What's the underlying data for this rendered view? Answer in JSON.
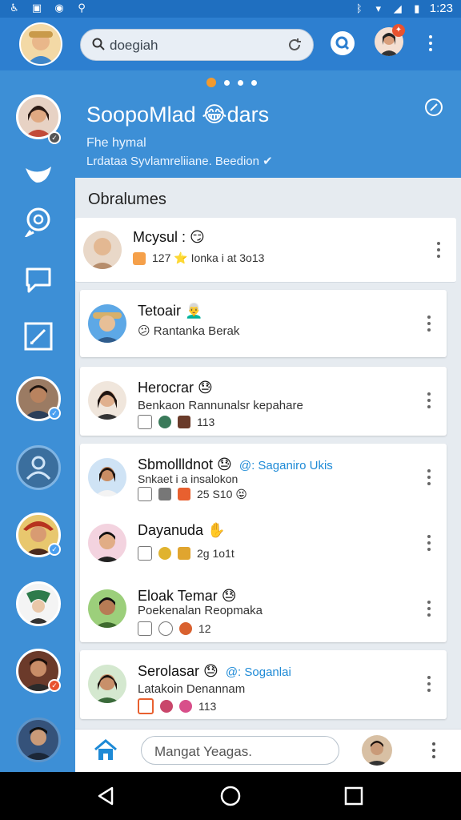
{
  "status_bar": {
    "time": "1:23"
  },
  "search": {
    "query": "doegiah"
  },
  "header": {
    "title": "SoopoMlad 😂dars",
    "line1": "Fhe hymal",
    "line2": "Lrdataa Syvlamreliiane. Beedion ✔"
  },
  "panel": {
    "title": "Obralumes"
  },
  "conversations": [
    {
      "name": "Mcysul : 😏",
      "line2": "",
      "line3": "127 ⭐ Ionka i at 3o13"
    },
    {
      "name": "Tetoair 👨‍🦳",
      "line2": "😕 Rantanka Berak",
      "line3": ""
    },
    {
      "name": "Herocrar 😓",
      "line2": "Benkaon Rannunalsr kepahare",
      "line3": "113"
    },
    {
      "name": "Sbmollldnot 😓",
      "accent": "@: Saganiro Ukis",
      "line2": "Snkaet i a insalokon",
      "line3": "25 S10 😝"
    },
    {
      "name": "Dayanuda ✋",
      "line2": "",
      "line3": "2g 1o1t"
    },
    {
      "name": "Eloak Temar 😓",
      "line2": "Poekenalan Reopmaka",
      "line3": "12"
    },
    {
      "name": "Serolasar 😓",
      "accent": "@: Soganlai",
      "line2": "Latakoin Denannam",
      "line3": "113"
    }
  ],
  "composer": {
    "placeholder": "Mangat Yeagas."
  },
  "colors": {
    "primary": "#2d7fd0",
    "sidebar": "#3d8fd6",
    "accent": "#1e8ad6",
    "badge": "#e8522f"
  }
}
